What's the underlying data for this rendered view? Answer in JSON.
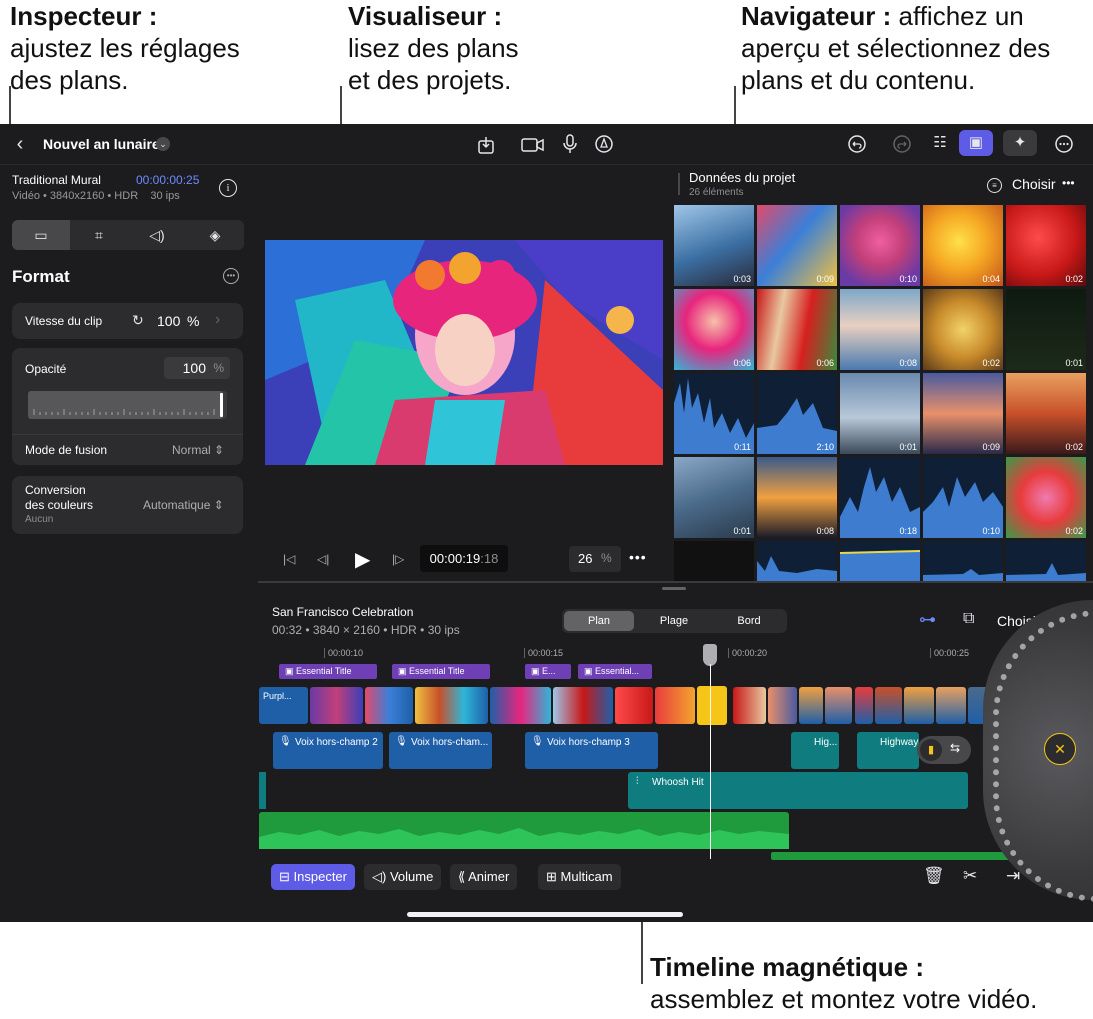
{
  "callouts": {
    "inspector_title": "Inspecteur :",
    "inspector_l1": "ajustez les réglages",
    "inspector_l2": "des plans.",
    "viewer_title": "Visualiseur :",
    "viewer_l1": "lisez des plans",
    "viewer_l2": "et des projets.",
    "browser_title": "Navigateur :",
    "browser_l1": " affichez un",
    "browser_l2": "aperçu et sélectionnez des",
    "browser_l3": "plans et du contenu.",
    "timeline_title": "Timeline magnétique :",
    "timeline_l1": "assemblez et montez votre vidéo."
  },
  "topbar": {
    "project_name": "Nouvel an lunaire",
    "icons": [
      "back-icon",
      "chevron-down-icon",
      "export-icon",
      "camera-icon",
      "mic-icon",
      "pen-icon",
      "undo-icon",
      "redo-icon",
      "inspector-toggle-icon",
      "photo-browser-icon",
      "effects-icon",
      "more-icon"
    ]
  },
  "inspector": {
    "clip_name": "Traditional Mural",
    "clip_time": "00:00:00:25",
    "clip_meta": "Vidéo • 3840x2160 • HDR    30 ips",
    "tabs": [
      "video-tab",
      "crop-tab",
      "audio-tab",
      "layers-tab"
    ],
    "section_title": "Format",
    "speed_label": "Vitesse du clip",
    "speed_value": "100",
    "speed_unit": "%",
    "opacity_label": "Opacité",
    "opacity_value": "100",
    "opacity_unit": "%",
    "blend_label": "Mode de fusion",
    "blend_value": "Normal",
    "color_label_1": "Conversion",
    "color_label_2": "des couleurs",
    "color_sub": "Aucun",
    "color_value": "Automatique"
  },
  "viewer": {
    "timecode": "00:00:19",
    "timecode_frames": ":18",
    "zoom_value": "26",
    "zoom_unit": "%"
  },
  "browser": {
    "title": "Données du projet",
    "count": "26 éléments",
    "choose": "Choisir",
    "durations": [
      "0:03",
      "0:09",
      "0:10",
      "0:04",
      "0:02",
      "0:06",
      "0:06",
      "0:08",
      "0:02",
      "0:01",
      "0:11",
      "2:10",
      "0:01",
      "0:09",
      "0:02",
      "0:01",
      "0:08",
      "0:18",
      "0:10",
      "0:02"
    ]
  },
  "timeline": {
    "project_name": "San Francisco Celebration",
    "project_meta": "00:32 • 3840 × 2160 • HDR • 30 ips",
    "segments": [
      "Plan",
      "Plage",
      "Bord"
    ],
    "choose": "Choisir",
    "ruler": [
      "00:00:10",
      "00:00:15",
      "00:00:20",
      "00:00:25"
    ],
    "titles": [
      "Essential Title",
      "Essential Title",
      "E...",
      "Essential..."
    ],
    "first_clip": "Purpl...",
    "voiceovers": [
      "Voix hors-champ 2",
      "Voix hors-cham...",
      "Voix hors-champ 3",
      "Hig...",
      "Highway"
    ],
    "sfx": "Whoosh Hit",
    "buttons": {
      "inspect": "Inspecter",
      "volume": "Volume",
      "animate": "Animer",
      "multicam": "Multicam"
    }
  },
  "colors": {
    "accent": "#5e5ce6",
    "timecode_blue": "#6c8cff",
    "title_purple": "#6e3fb5",
    "video_blue": "#1f5fa8",
    "sfx_teal": "#0f7c80",
    "music_green": "#1f9a3c",
    "playhead_yellow": "#f5c518"
  }
}
